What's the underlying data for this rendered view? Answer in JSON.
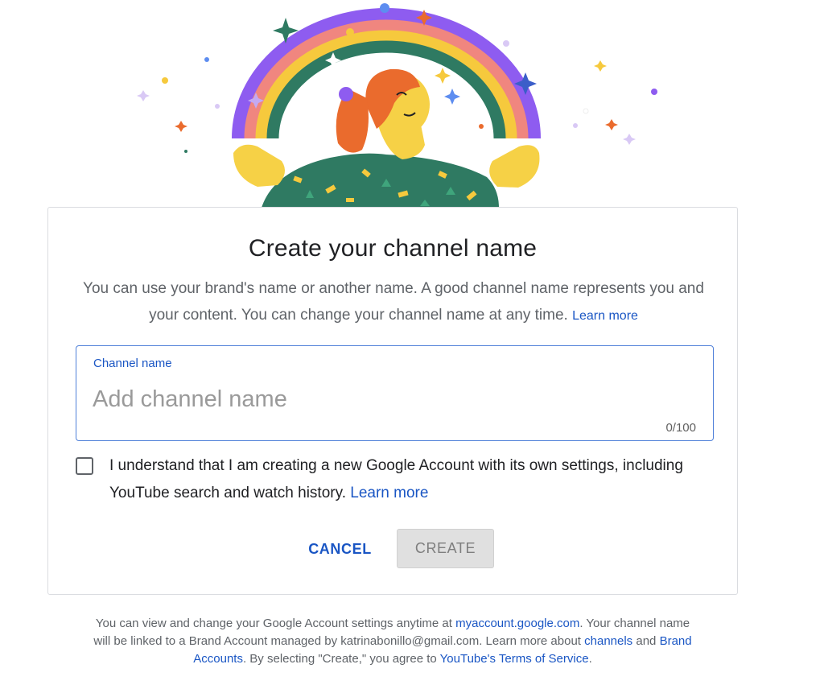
{
  "dialog": {
    "title": "Create your channel name",
    "description": "You can use your brand's name or another name. A good channel name represents you and your content. You can change your channel name at any time.",
    "learn_more": "Learn more"
  },
  "channel_field": {
    "label": "Channel name",
    "placeholder": "Add channel name",
    "value": "",
    "counter": "0/100"
  },
  "acknowledge": {
    "checked": false,
    "text": "I understand that I am creating a new Google Account with its own settings, including YouTube search and watch history.",
    "learn_more": "Learn more"
  },
  "actions": {
    "cancel": "CANCEL",
    "create": "CREATE"
  },
  "footer": {
    "part1": "You can view and change your Google Account settings anytime at",
    "link_account": "myaccount.google.com",
    "part2": ". Your channel name will be linked to a Brand Account managed by katrinabonillo@gmail.com. Learn more about",
    "link_channels": "channels",
    "part3": "and",
    "link_brand": "Brand Accounts",
    "part4": ". By selecting \"Create,\" you agree to",
    "link_tos": "YouTube's Terms of Service",
    "part5": "."
  },
  "colors": {
    "accent": "#1a56c4",
    "field_border": "#4f80d9",
    "disabled_button": "#e0e0e0",
    "rainbow": [
      "#8e5cf0",
      "#f0867f",
      "#f6c93d",
      "#2f7a62"
    ]
  },
  "icons": [
    "sparkle-icon",
    "checkbox-icon"
  ]
}
